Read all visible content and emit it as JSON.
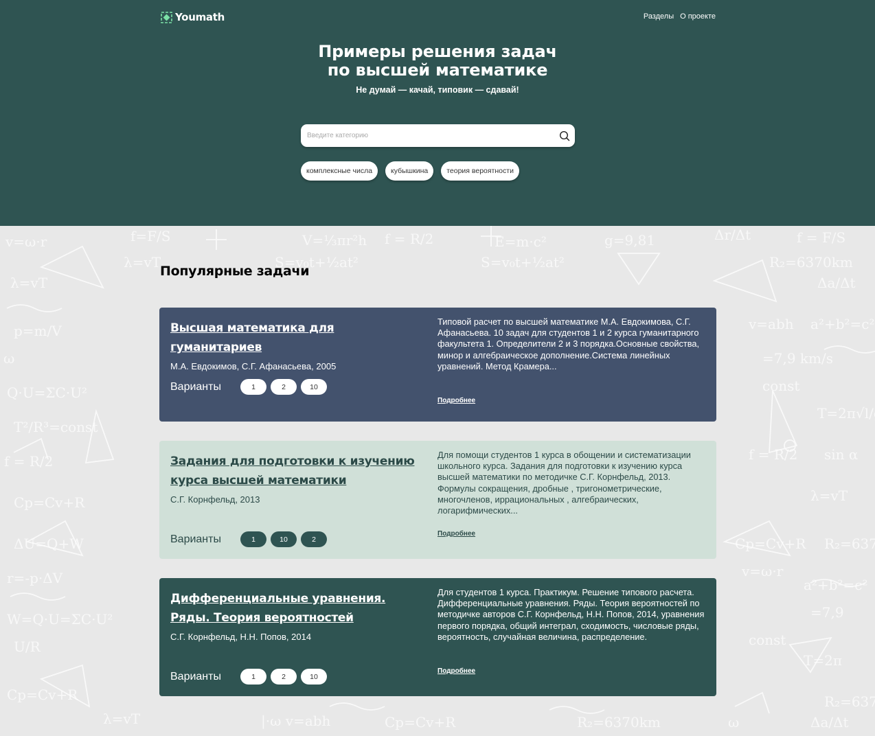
{
  "header": {
    "logo_text": "Youmath",
    "nav": [
      "Разделы",
      "О проекте"
    ]
  },
  "hero": {
    "title_line1": "Примеры решения задач",
    "title_line2": "по высшей математике",
    "subtitle": "Не думай — качай, типовик — сдавай!",
    "search_placeholder": "Введите категорию",
    "search_icon": "search-icon",
    "tags": [
      "комплексные числа",
      "кубышкина",
      "теория вероятности"
    ]
  },
  "popular": {
    "title": "Популярные задачи",
    "variants_label": "Варианты",
    "more_label": "Подробнее",
    "cards": [
      {
        "title": "Высшая математика для гуманитариев",
        "meta": "М.А. Евдокимов, С.Г. Афанасьева, 2005",
        "variants": [
          "1",
          "2",
          "10"
        ],
        "description": "Типовой расчет по высшей математике М.А. Евдокимова, С.Г. Афанасьева. 10 задач для студентов 1 и 2 курса гуманитарного факультета 1. Определители 2 и 3 порядка.Основные свойства, минор и алгебраическое дополнение.Система линейных уравнений. Метод Крамера...",
        "color": "#43526d"
      },
      {
        "title": "Задания для подготовки к изучению курса высшей математики",
        "meta": "С.Г. Корнфельд, 2013",
        "variants": [
          "1",
          "10",
          "2"
        ],
        "description": "Для помощи студентов 1 курса в обощении и систематизации школьного курса. Задания для подготовки к изучению курса высшей математики по методичке С.Г. Корнфельд, 2013. Формулы сокращения, дробные , тригонометрические, многочленов, иррациональных , алгебраических, логарифмических...",
        "color": "#d0e0d8"
      },
      {
        "title": "Дифференциальные уравнения. Ряды. Теория вероятностей",
        "meta": "С.Г. Корнфельд, Н.Н. Попов, 2014",
        "variants": [
          "1",
          "2",
          "10"
        ],
        "description": "Для студентов 1 курса. Практикум. Решение типового расчета. Дифференциальные уравнения. Ряды. Теория вероятностей по методичке авторов С.Г. Корнфельд, Н.Н. Попов, 2014, уравнения первого порядка, общий интеграл, сходимость, числовые ряды, вероятность, случайная величина, распределение.",
        "color": "#2f5452"
      }
    ]
  }
}
